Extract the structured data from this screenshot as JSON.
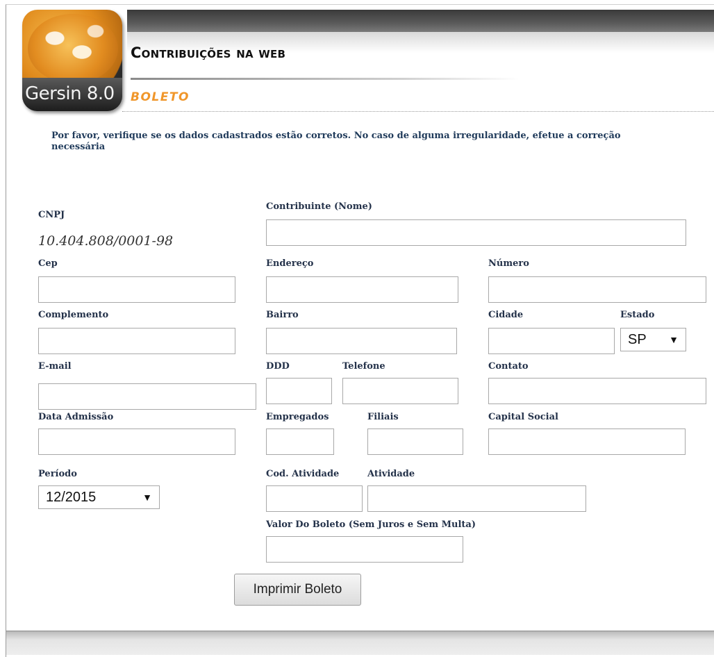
{
  "header": {
    "logo_text": "Gersin 8.0",
    "title": "Contribuições na web",
    "subtitle": "BOLETO"
  },
  "notice": "Por favor, verifique se os dados cadastrados estão corretos. No caso de alguma irregularidade, efetue a correção necessária",
  "form": {
    "cnpj": {
      "label": "CNPJ",
      "value": "10.404.808/0001-98"
    },
    "contribuinte": {
      "label": "Contribuinte (Nome)",
      "value": ""
    },
    "cep": {
      "label": "Cep",
      "value": ""
    },
    "endereco": {
      "label": "Endereço",
      "value": ""
    },
    "numero": {
      "label": "Número",
      "value": ""
    },
    "complemento": {
      "label": "Complemento",
      "value": ""
    },
    "bairro": {
      "label": "Bairro",
      "value": ""
    },
    "cidade": {
      "label": "Cidade",
      "value": ""
    },
    "estado": {
      "label": "Estado",
      "value": "SP"
    },
    "email": {
      "label": "E-mail",
      "value": ""
    },
    "ddd": {
      "label": "DDD",
      "value": ""
    },
    "telefone": {
      "label": "Telefone",
      "value": ""
    },
    "contato": {
      "label": "Contato",
      "value": ""
    },
    "data_admissao": {
      "label": "Data Admissão",
      "value": ""
    },
    "empregados": {
      "label": "Empregados",
      "value": ""
    },
    "filiais": {
      "label": "Filiais",
      "value": ""
    },
    "capital_social": {
      "label": "Capital Social",
      "value": ""
    },
    "periodo": {
      "label": "Período",
      "value": "12/2015"
    },
    "cod_atividade": {
      "label": "Cod. Atividade",
      "value": ""
    },
    "atividade": {
      "label": "Atividade",
      "value": ""
    },
    "valor_boleto": {
      "label": "Valor Do Boleto (Sem Juros e Sem Multa)",
      "value": ""
    }
  },
  "actions": {
    "print_label": "Imprimir Boleto"
  }
}
